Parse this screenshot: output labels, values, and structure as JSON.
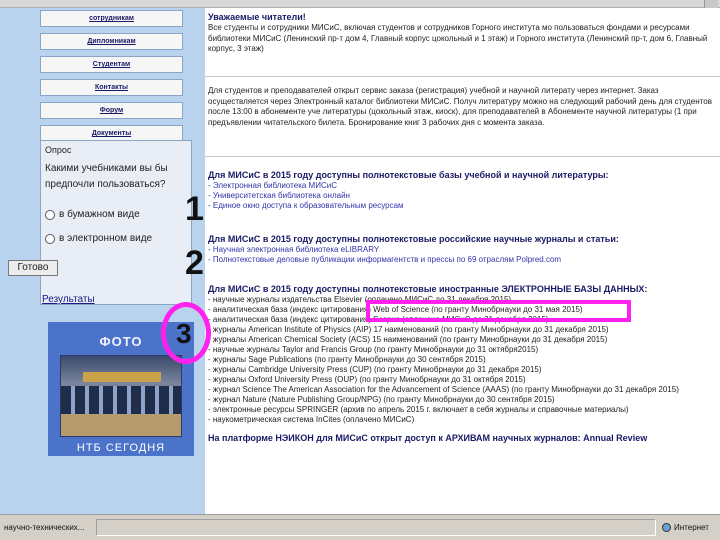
{
  "sidebar": {
    "nav": [
      {
        "label": "сотрудникам"
      },
      {
        "label": "Дипломникам"
      },
      {
        "label": "Студентам"
      },
      {
        "label": "Контакты"
      },
      {
        "label": "Форум"
      },
      {
        "label": "Документы"
      }
    ],
    "poll": {
      "title": "Опрос",
      "question": "Какими учебниками вы бы предпочли пользоваться?",
      "options": [
        "в бумажном виде",
        "в электронном виде"
      ],
      "vote_label": "Готово",
      "results_label": "Результаты"
    },
    "photo": {
      "label": "ФОТО",
      "caption": "НТБ СЕГОДНЯ"
    }
  },
  "main": {
    "b1": {
      "heading": "Уважаемые читатели!",
      "text": "Все студенты и сотрудники МИСиС, включая студентов и сотрудников Горного института мо пользоваться фондами и ресурсами библиотеки МИСиС (Ленинский пр-т дом 4, Главный корпус цокольный и 1 этаж) и Горного института (Ленинский пр-т, дом 6, Главный корпус, 3 этаж)"
    },
    "b2": {
      "text": "Для студентов и преподавателей открыт сервис заказа (регистрация) учебной и научной литерату через интернет. Заказ осуществляется через Электронный каталог библиотеки МИСиС. Получ литературу можно на следующий рабочий день для студентов после 13:00 в абонементе уче литературы (цокольный этаж, киоск), для преподавателей в Абонементе научной литературы (1 при предъявлении читательского билета. Бронирование книг 3 рабочих дня с момента заказа."
    },
    "b3": {
      "heading": "Для МИСиС в 2015 году доступны полнотекстовые базы учебной и научной литературы:",
      "items": [
        "- Электронная библиотека МИСиС",
        "- Университетская библиотека онлайн",
        "- Единое окно доступа к образовательным ресурсам"
      ]
    },
    "b4": {
      "heading": "Для МИСиС в 2015 году доступны полнотекстовые российские научные журналы и статьи:",
      "items": [
        "- Научная электронная библиотека eLIBRARY",
        "- Полнотекстовые деловые публикации информагентств и прессы по 69 отраслям Polpred.com"
      ]
    },
    "b5": {
      "heading": "Для МИСиС в 2015 году доступны полнотекстовые иностранные ЭЛЕКТРОННЫЕ БАЗЫ ДАННЫХ:",
      "items": [
        "- научные журналы издательства Elsevier (оплачено МИСиС до 31 декабря 2015)",
        "- аналитическая база (индекс цитирования) Web of Science (по гранту Минобрнауки до 31 мая 2015)",
        "- аналитическая база (индекс цитирования) Scopus (оплачено МИСиС до 31 декабря 2015)",
        "- журналы American Institute of Physics (AIP) 17 наименований (по гранту Минобрнауки до 31 декабря 2015)",
        "- журналы American Chemical Society (ACS) 15 наименований (по гранту Минобрнауки до 31 декабря 2015)",
        "- научные журналы Taylor and Francis Group (по гранту Минобрнауки до 31 октября2015)",
        "- журналы Sage Publications (по гранту Минобрнауки до 30 сентября 2015)",
        "- журналы Cambridge University Press (CUP) (по гранту Минобрнауки до 31 декабря 2015)",
        "- журналы Oxford University Press (OUP) (по гранту Минобрнауки до 31 октября 2015)",
        "- журнал Science The American Association for the Advancement of Science (AAAS) (по гранту Минобрнауки до 31 декабря 2015)",
        "- журнал Nature (Nature Publishing Group/NPG) (по гранту Минобрнауки до 30 сентября 2015)",
        "- электронные ресурсы SPRINGER (архив по апрель 2015 г. включает в себя журналы и справочные материалы)",
        "- наукометрическая система InCites (оплачено МИСиС)"
      ],
      "footer": "На платформе НЭИКОН для МИСиС открыт доступ к АРХИВАМ научных журналов: Annual Review"
    }
  },
  "annotations": {
    "marker1": "1",
    "marker2": "2",
    "marker3": "3"
  },
  "statusbar": {
    "text": "научно-технических...",
    "zone": "Интернет"
  }
}
